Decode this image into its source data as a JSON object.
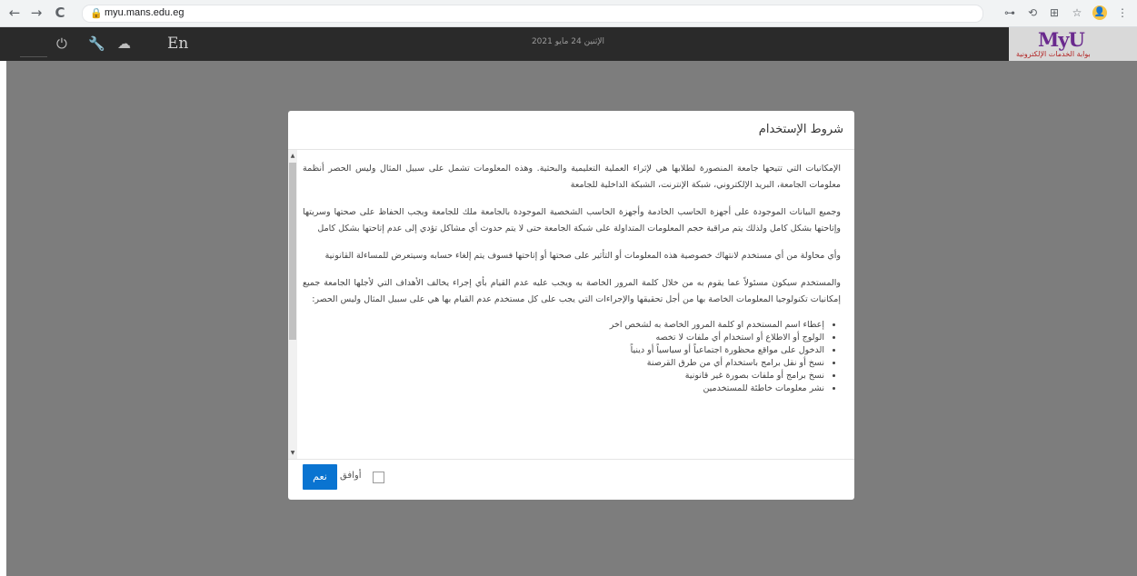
{
  "browser": {
    "url": "myu.mans.edu.eg",
    "back_icon": "←",
    "forward_icon": "→",
    "reload_icon": "C",
    "lock_icon": "🔒",
    "ext_icons": [
      "⊶",
      "⟲",
      "⊞",
      "☆",
      "⋮"
    ],
    "avatar_glyph": "👤"
  },
  "header": {
    "icons": [
      "power-icon",
      "wrench-icon",
      "cloud-icon"
    ],
    "power_glyph": "⏻",
    "wrench_glyph": "🔧",
    "cloud_glyph": "☁",
    "language": "En",
    "date": "الإثنين 24 مايو 2021",
    "logo_text": "MyU",
    "logo_subtitle": "بوابة الخدمات الإلكترونية"
  },
  "modal": {
    "title": "شروط الإستخدام",
    "paragraphs": [
      "الإمكانيات التي تتيحها جامعة المنصورة لطلابها هي لإثراء العملية التعليمية والبحثية. وهذه المعلومات تشمل على سبيل المثال وليس الحصر أنظمة معلومات الجامعة، البريد الإلكتروني، شبكة الإنترنت، الشبكة الداخلية للجامعة",
      "وجميع البيانات الموجودة على أجهزة الحاسب الخادمة وأجهزة الحاسب الشخصية الموجودة بالجامعة ملك للجامعة ويجب الحفاظ على صحتها وسريتها وإتاحتها بشكل كامل ولذلك يتم مراقبة حجم المعلومات المتداولة على شبكة الجامعة حتى لا يتم حدوث أي مشاكل تؤدي إلى عدم إتاحتها بشكل كامل",
      "وأي محاولة من أي مستخدم لانتهاك خصوصية هذه المعلومات أو التأثير على صحتها أو إتاحتها فسوف يتم إلغاء حسابه وسيتعرض للمساءلة القانونية",
      "والمستخدم سيكون مسئولاً عما يقوم به من خلال كلمة المرور الخاصة به ويجب عليه عدم القيام بأي إجراء يخالف الأهداف التي لأجلها الجامعة جميع إمكانيات تكنولوجيا المعلومات الخاصة بها من أجل تحقيقها والإجراءات التي يجب على كل مستخدم عدم القيام بها هي على سبيل المثال وليس الحصر:"
    ],
    "bullets": [
      "إعطاء اسم المستخدم او كلمة المرور الخاصة به لشخص اخر",
      "الولوج أو الاطلاع أو استخدام أي ملفات لا تخصه",
      "الدخول على مواقع محظورة اجتماعياً أو سياسياً أو دينياً",
      "نسخ أو نقل برامج باستخدام أي من طرق القرصنة",
      "نسخ برامج أو ملفات بصورة غير قانونية",
      "نشر معلومات خاطئة للمستخدمين"
    ],
    "agree_label": "أوافق",
    "yes_button": "نعم",
    "scroll_up_glyph": "▲",
    "scroll_down_glyph": "▼"
  }
}
